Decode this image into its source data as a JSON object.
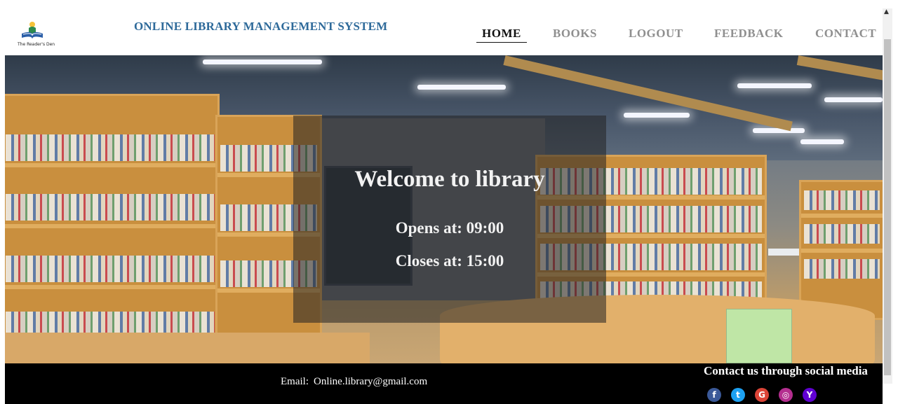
{
  "header": {
    "logo_caption": "The Reader's Den",
    "title": "ONLINE LIBRARY MANAGEMENT SYSTEM"
  },
  "nav": {
    "items": [
      {
        "label": "HOME",
        "active": true
      },
      {
        "label": "BOOKS",
        "active": false
      },
      {
        "label": "LOGOUT",
        "active": false
      },
      {
        "label": "FEEDBACK",
        "active": false
      },
      {
        "label": "CONTACT",
        "active": false
      }
    ]
  },
  "hero": {
    "welcome": "Welcome to library",
    "opens": "Opens at: 09:00",
    "closes": "Closes at: 15:00"
  },
  "footer": {
    "email_label": "Email:",
    "email_value": "Online.library@gmail.com",
    "social_title": "Contact us through social media",
    "socials": [
      {
        "icon": "facebook-icon",
        "glyph": "f",
        "color": "#3b5998"
      },
      {
        "icon": "twitter-icon",
        "glyph": "t",
        "color": "#1da1f2"
      },
      {
        "icon": "google-icon",
        "glyph": "G",
        "color": "#db4437"
      },
      {
        "icon": "instagram-icon",
        "glyph": "◎",
        "color": "#b42e8f"
      },
      {
        "icon": "yahoo-icon",
        "glyph": "Y",
        "color": "#6001d2"
      }
    ]
  }
}
